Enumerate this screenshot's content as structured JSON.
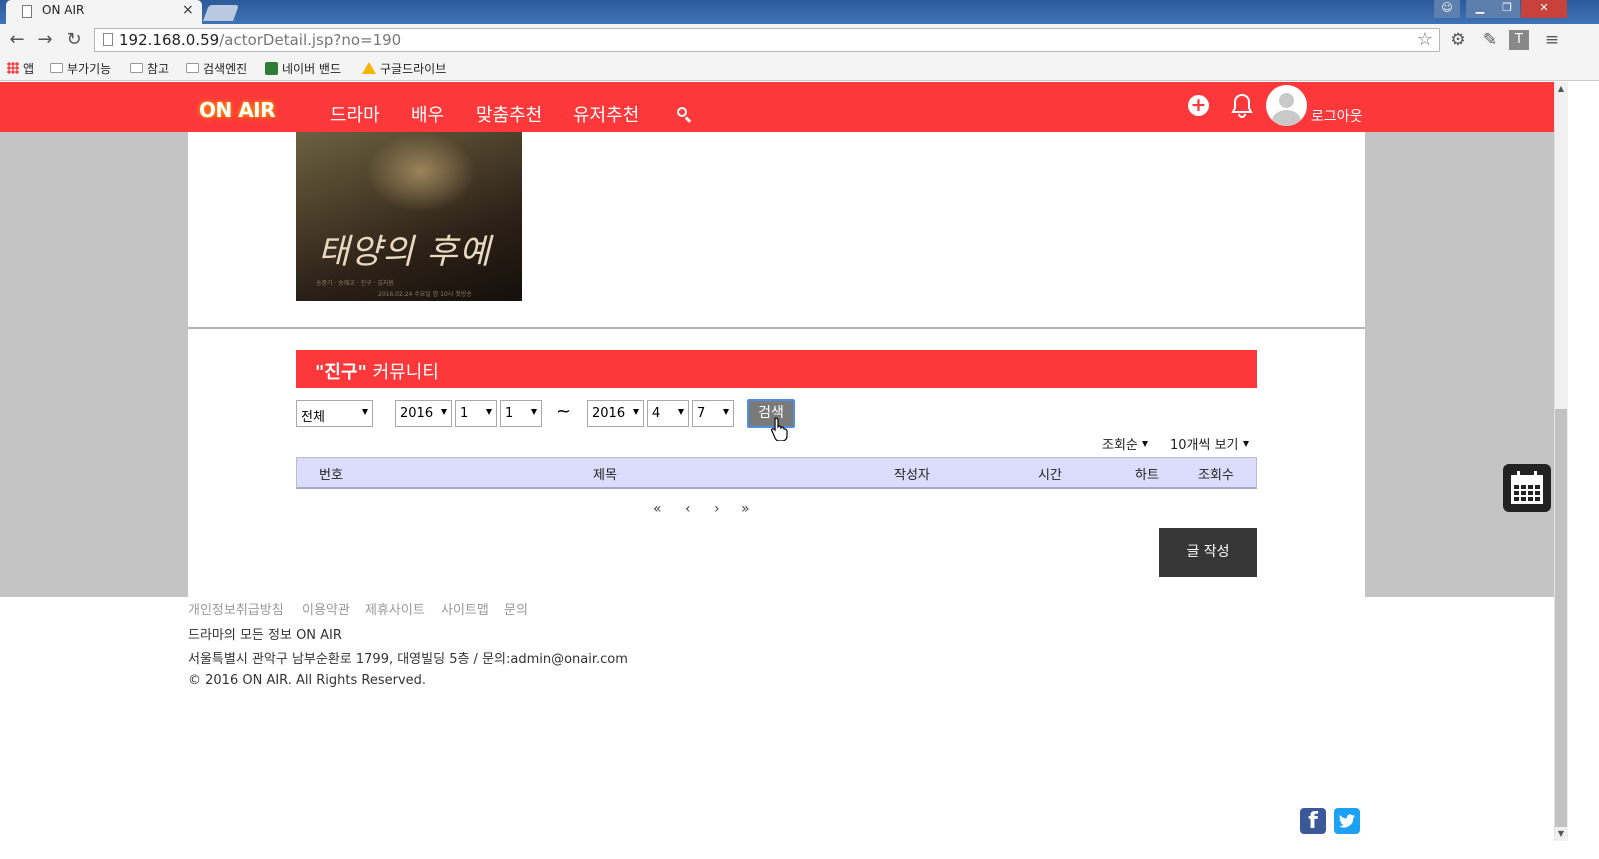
{
  "browser": {
    "tab_title": "ON AIR",
    "tab_close": "×",
    "url_host": "192.168.0.59",
    "url_path": "/actorDetail.jsp?no=190",
    "bookmarks": [
      "앱",
      "부가기능",
      "참고",
      "검색엔진",
      "네이버 밴드",
      "구글드라이브"
    ]
  },
  "site": {
    "logo": "ON AIR",
    "nav": [
      "드라마",
      "배우",
      "맞춤추천",
      "유저추천"
    ],
    "logout": "로그아웃"
  },
  "poster": {
    "title": "태양의 후예",
    "credits": "송중기 · 송혜교 · 진구 · 김지원",
    "date": "2016.02.24 수요일 밤 10시 첫방송"
  },
  "community": {
    "title_quoted": "\"진구\"",
    "title_suffix": " 커뮤니티",
    "filter_category": "전체",
    "from": {
      "year": "2016",
      "month": "1",
      "day": "1"
    },
    "tilde": "~",
    "to": {
      "year": "2016",
      "month": "4",
      "day": "7"
    },
    "search_label": "검색",
    "sort_label": "조회순",
    "page_size_label": "10개씩 보기",
    "columns": [
      "번호",
      "제목",
      "작성자",
      "시간",
      "하트",
      "조회수"
    ],
    "pagination": [
      "«",
      "‹",
      "›",
      "»"
    ],
    "write_label": "글 작성"
  },
  "footer": {
    "links": [
      "개인정보취급방침",
      "이용약관",
      "제휴사이트",
      "사이트맵",
      "문의"
    ],
    "tagline": "드라마의 모든 정보 ON AIR",
    "address": "서울특별시 관악구 남부순환로 1799, 대영빌딩 5층 / 문의:admin@onair.com",
    "copyright": "© 2016 ON AIR. All Rights Reserved."
  },
  "colors": {
    "brand": "#fc383a",
    "table_header": "#dcdcfc",
    "write_button": "#363636"
  }
}
